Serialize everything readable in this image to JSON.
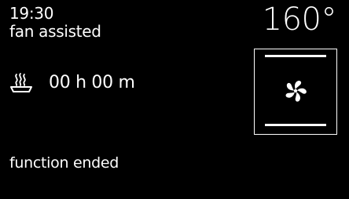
{
  "header": {
    "time": "19:30",
    "mode": "fan assisted",
    "temperature": "160°"
  },
  "timer": {
    "icon": "dish-steam-icon",
    "duration": "00 h 00 m"
  },
  "oven_indicator": {
    "top_heating": true,
    "bottom_heating": true,
    "icon": "fan-icon"
  },
  "status": {
    "message": "function ended"
  },
  "colors": {
    "background": "#000000",
    "foreground": "#ffffff"
  }
}
